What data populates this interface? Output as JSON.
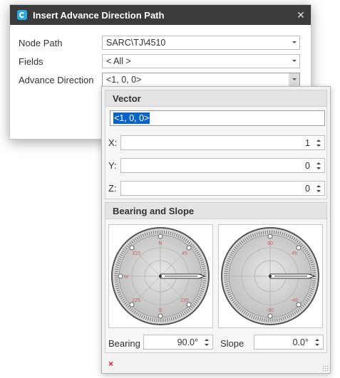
{
  "dialog": {
    "title": "Insert Advance Direction Path",
    "close_glyph": "✕",
    "fields": [
      {
        "label": "Node Path",
        "value": "SARC\\TJ\\4510"
      },
      {
        "label": "Fields",
        "value": "< All >"
      },
      {
        "label": "Advance Direction",
        "value": "<1, 0, 0>"
      }
    ]
  },
  "popup": {
    "vector": {
      "header": "Vector",
      "text": "<1, 0, 0>",
      "rows": [
        {
          "label": "X:",
          "value": "1"
        },
        {
          "label": "Y:",
          "value": "0"
        },
        {
          "label": "Z:",
          "value": "0"
        }
      ]
    },
    "bearing_slope": {
      "header": "Bearing and Slope",
      "bearing_dial": {
        "N": "N",
        "E": "E",
        "S": "S",
        "W": "W",
        "d45": "45",
        "d135": "135",
        "d225": "225",
        "d315": "315"
      },
      "slope_dial": {
        "top": "90",
        "d45": "45",
        "dm45": "-45",
        "bottom": "-90"
      },
      "bearing_label": "Bearing",
      "bearing_value": "90.0°",
      "slope_label": "Slope",
      "slope_value": "0.0°"
    },
    "status_icon": "×"
  },
  "colors": {
    "title_bar": "#3b3b3b",
    "selection": "#0a64c8",
    "error": "#d9202c"
  }
}
